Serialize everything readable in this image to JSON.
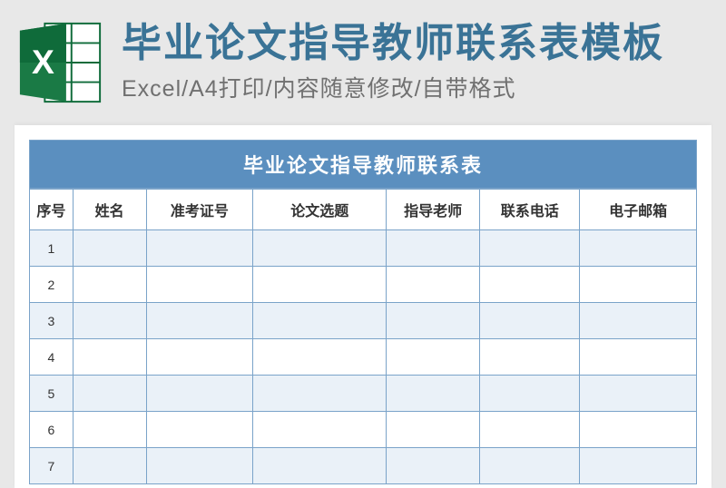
{
  "header": {
    "main_title": "毕业论文指导教师联系表模板",
    "sub_title": "Excel/A4打印/内容随意修改/自带格式"
  },
  "sheet": {
    "title": "毕业论文指导教师联系表",
    "columns": {
      "seq": "序号",
      "name": "姓名",
      "exam": "准考证号",
      "topic": "论文选题",
      "teacher": "指导老师",
      "phone": "联系电话",
      "email": "电子邮箱"
    },
    "rows": [
      {
        "seq": "1",
        "name": "",
        "exam": "",
        "topic": "",
        "teacher": "",
        "phone": "",
        "email": ""
      },
      {
        "seq": "2",
        "name": "",
        "exam": "",
        "topic": "",
        "teacher": "",
        "phone": "",
        "email": ""
      },
      {
        "seq": "3",
        "name": "",
        "exam": "",
        "topic": "",
        "teacher": "",
        "phone": "",
        "email": ""
      },
      {
        "seq": "4",
        "name": "",
        "exam": "",
        "topic": "",
        "teacher": "",
        "phone": "",
        "email": ""
      },
      {
        "seq": "5",
        "name": "",
        "exam": "",
        "topic": "",
        "teacher": "",
        "phone": "",
        "email": ""
      },
      {
        "seq": "6",
        "name": "",
        "exam": "",
        "topic": "",
        "teacher": "",
        "phone": "",
        "email": ""
      },
      {
        "seq": "7",
        "name": "",
        "exam": "",
        "topic": "",
        "teacher": "",
        "phone": "",
        "email": ""
      }
    ]
  },
  "colors": {
    "accent": "#3a7396",
    "table_header_bg": "#5b8fbf",
    "border": "#7aa3c9",
    "row_alt": "#eaf1f8"
  }
}
